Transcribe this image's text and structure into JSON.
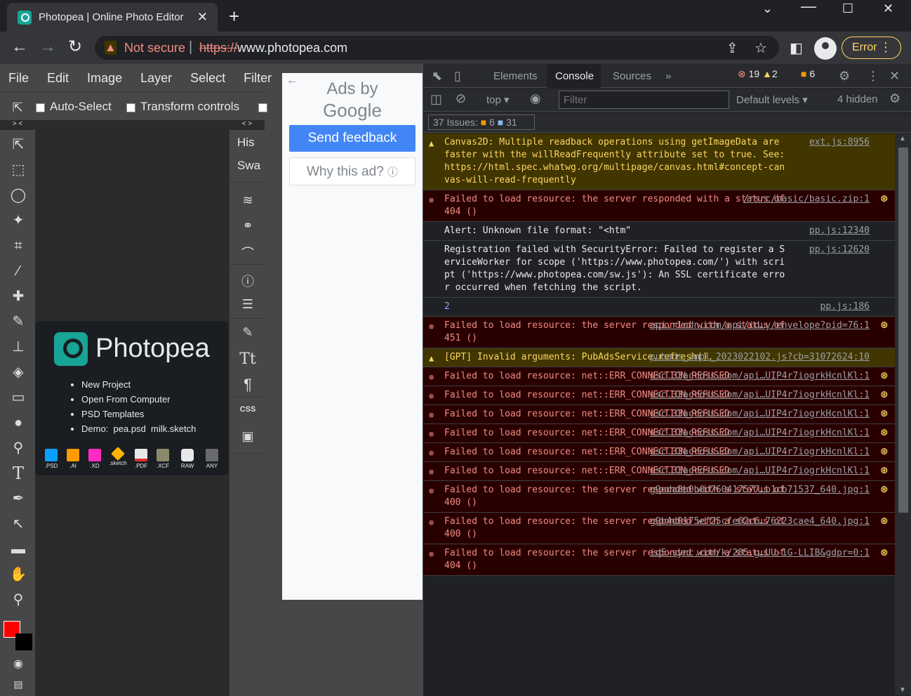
{
  "browser": {
    "tab_title": "Photopea | Online Photo Editor",
    "not_secure": "Not secure",
    "url_scheme": "https://",
    "url_host": "www.photopea.com",
    "error_label": "Error"
  },
  "photopea": {
    "menu": [
      "File",
      "Edit",
      "Image",
      "Layer",
      "Select",
      "Filter"
    ],
    "auto_select": "Auto-Select",
    "transform_controls": "Transform controls",
    "panel_history": "His",
    "panel_swatches": "Swa",
    "logo_text": "Photopea",
    "welcome_items": [
      "New Project",
      "Open From Computer",
      "PSD Templates"
    ],
    "demo_label": "Demo:",
    "demo_links": [
      "pea.psd",
      "milk.sketch"
    ],
    "formats": [
      ".PSD",
      ".AI",
      ".XD",
      ".sketch",
      ".PDF",
      ".XCF",
      "RAW",
      "ANY"
    ],
    "css_label": "CSS",
    "collapse_left": "> <",
    "collapse_right": "< >"
  },
  "ad": {
    "ads_by": "Ads by",
    "google": "Google",
    "send_feedback": "Send feedback",
    "why_ad": "Why this ad?"
  },
  "devtools": {
    "tabs": [
      "Elements",
      "Console",
      "Sources"
    ],
    "err_count": "19",
    "warn_count": "2",
    "issue_count": "6",
    "context": "top",
    "filter_placeholder": "Filter",
    "levels": "Default levels",
    "hidden": "4 hidden",
    "issues_label": "37 Issues:",
    "issues_warn": "6",
    "issues_info": "31",
    "rows": [
      {
        "type": "warn",
        "msg": "Canvas2D: Multiple readback operations using getImageData are faster with the willReadFrequently attribute set to true. See: https://html.spec.whatwg.org/multipage/canvas.html#concept-canvas-will-read-frequently",
        "src": "ext.js:8956"
      },
      {
        "type": "err",
        "msg": "Failed to load resource: the server responded with a status of 404 ()",
        "src": "/rsrc/basic/basic.zip:1"
      },
      {
        "type": "info",
        "msg": "Alert: Unknown file format: \"<htm\"",
        "src": "pp.js:12340"
      },
      {
        "type": "info",
        "msg": "Registration failed with SecurityError: Failed to register a ServiceWorker for scope ('https://www.photopea.com/') with script ('https://www.photopea.com/sw.js'): An SSL certificate error occurred when fetching the script.",
        "src": "pp.js:12620"
      },
      {
        "type": "num",
        "msg": "2",
        "src": "pp.js:186"
      },
      {
        "type": "err",
        "msg": "Failed to load resource: the server responded with a status of 451 ()",
        "src": "api.rlcdn.com/api/id…y/envelope?pid=76:1"
      },
      {
        "type": "warn",
        "msg": "[GPT] Invalid arguments: PubAdsService.refresh().",
        "src": "pubads_impl_2023022102.js?cb=31072624:10"
      },
      {
        "type": "err",
        "msg": "Failed to load resource: net::ERR_CONNECTION_REFUSED",
        "src": "ssc.33across.com/api…UIP4r7iogrkHcnlKl:1"
      },
      {
        "type": "err",
        "msg": "Failed to load resource: net::ERR_CONNECTION_REFUSED",
        "src": "ssc.33across.com/api…UIP4r7iogrkHcnlKl:1"
      },
      {
        "type": "err",
        "msg": "Failed to load resource: net::ERR_CONNECTION_REFUSED",
        "src": "ssc.33across.com/api…UIP4r7iogrkHcnlKl:1"
      },
      {
        "type": "err",
        "msg": "Failed to load resource: net::ERR_CONNECTION_REFUSED",
        "src": "ssc.33across.com/api…UIP4r7iogrkHcnlKl:1"
      },
      {
        "type": "err",
        "msg": "Failed to load resource: net::ERR_CONNECTION_REFUSED",
        "src": "ssc.33across.com/api…UIP4r7iogrkHcnlKl:1"
      },
      {
        "type": "err",
        "msg": "Failed to load resource: net::ERR_CONNECTION_REFUSED",
        "src": "ssc.33across.com/api…UIP4r7iogrkHcnlKl:1"
      },
      {
        "type": "err",
        "msg": "Failed to load resource: the server responded with a status of 400 ()",
        "src": "g9eda8b0b0d760417577…b1cb71537_640.jpg:1"
      },
      {
        "type": "err",
        "msg": "Failed to load resource: the server responded with a status of 400 ()",
        "src": "g9b4d0175ef25cfe62c6…76223cae4_640.jpg:1"
      },
      {
        "type": "err",
        "msg": "Failed to load resource: the server responded with a status of 404 ()",
        "src": "id5-sync.com/k/285.g…UU-1G-LLIB&gdpr=0:1"
      }
    ]
  }
}
